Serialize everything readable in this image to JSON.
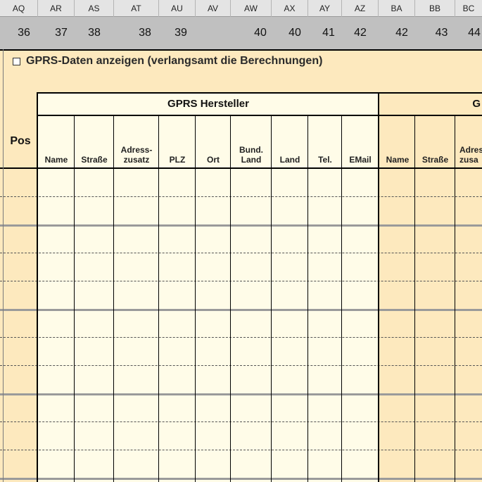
{
  "columns": [
    "AQ",
    "AR",
    "AS",
    "AT",
    "AU",
    "AV",
    "AW",
    "AX",
    "AY",
    "AZ",
    "BA",
    "BB",
    "BC"
  ],
  "row_numbers": [
    "36",
    "37",
    "38",
    "38",
    "39",
    "",
    "40",
    "40",
    "41",
    "42",
    "42",
    "43",
    "44"
  ],
  "checkbox": {
    "label": "GPRS-Daten anzeigen (verlangsamt die Berechnungen)",
    "checked": false
  },
  "groups": {
    "hersteller": "GPRS Hersteller",
    "second": "G"
  },
  "pos_label": "Pos",
  "fields": [
    "Name",
    "Straße",
    "Adress-\nzusatz",
    "PLZ",
    "Ort",
    "Bund.\nLand",
    "Land",
    "Tel.",
    "EMail",
    "Name",
    "Straße",
    "Adress\nzusa"
  ],
  "colors": {
    "header_bg": "#e4e4e4",
    "num_row_bg": "#c0c0c0",
    "sheet_bg": "#fde9be",
    "cell_bg": "#fffce8",
    "highlight_bg": "#fde9be"
  }
}
